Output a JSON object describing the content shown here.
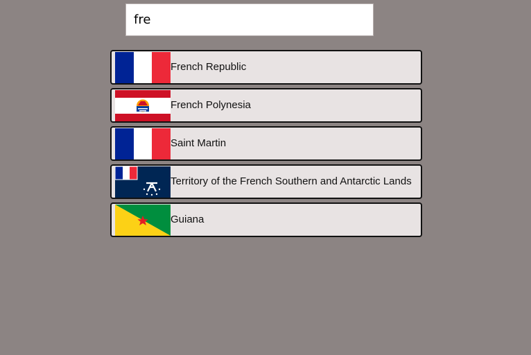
{
  "search": {
    "value": "fre",
    "placeholder": ""
  },
  "results": [
    {
      "name": "French Republic",
      "flag": "flag-france-icon"
    },
    {
      "name": "French Polynesia",
      "flag": "flag-french-polynesia-icon"
    },
    {
      "name": "Saint Martin",
      "flag": "flag-saint-martin-icon"
    },
    {
      "name": "Territory of the French Southern and Antarctic Lands",
      "flag": "flag-taaf-icon"
    },
    {
      "name": "Guiana",
      "flag": "flag-french-guiana-icon"
    }
  ],
  "colors": {
    "background": "#8c8483",
    "row_background": "#e8e3e3",
    "row_border": "#111111",
    "france_blue": "#002395",
    "france_red": "#ed2939"
  }
}
